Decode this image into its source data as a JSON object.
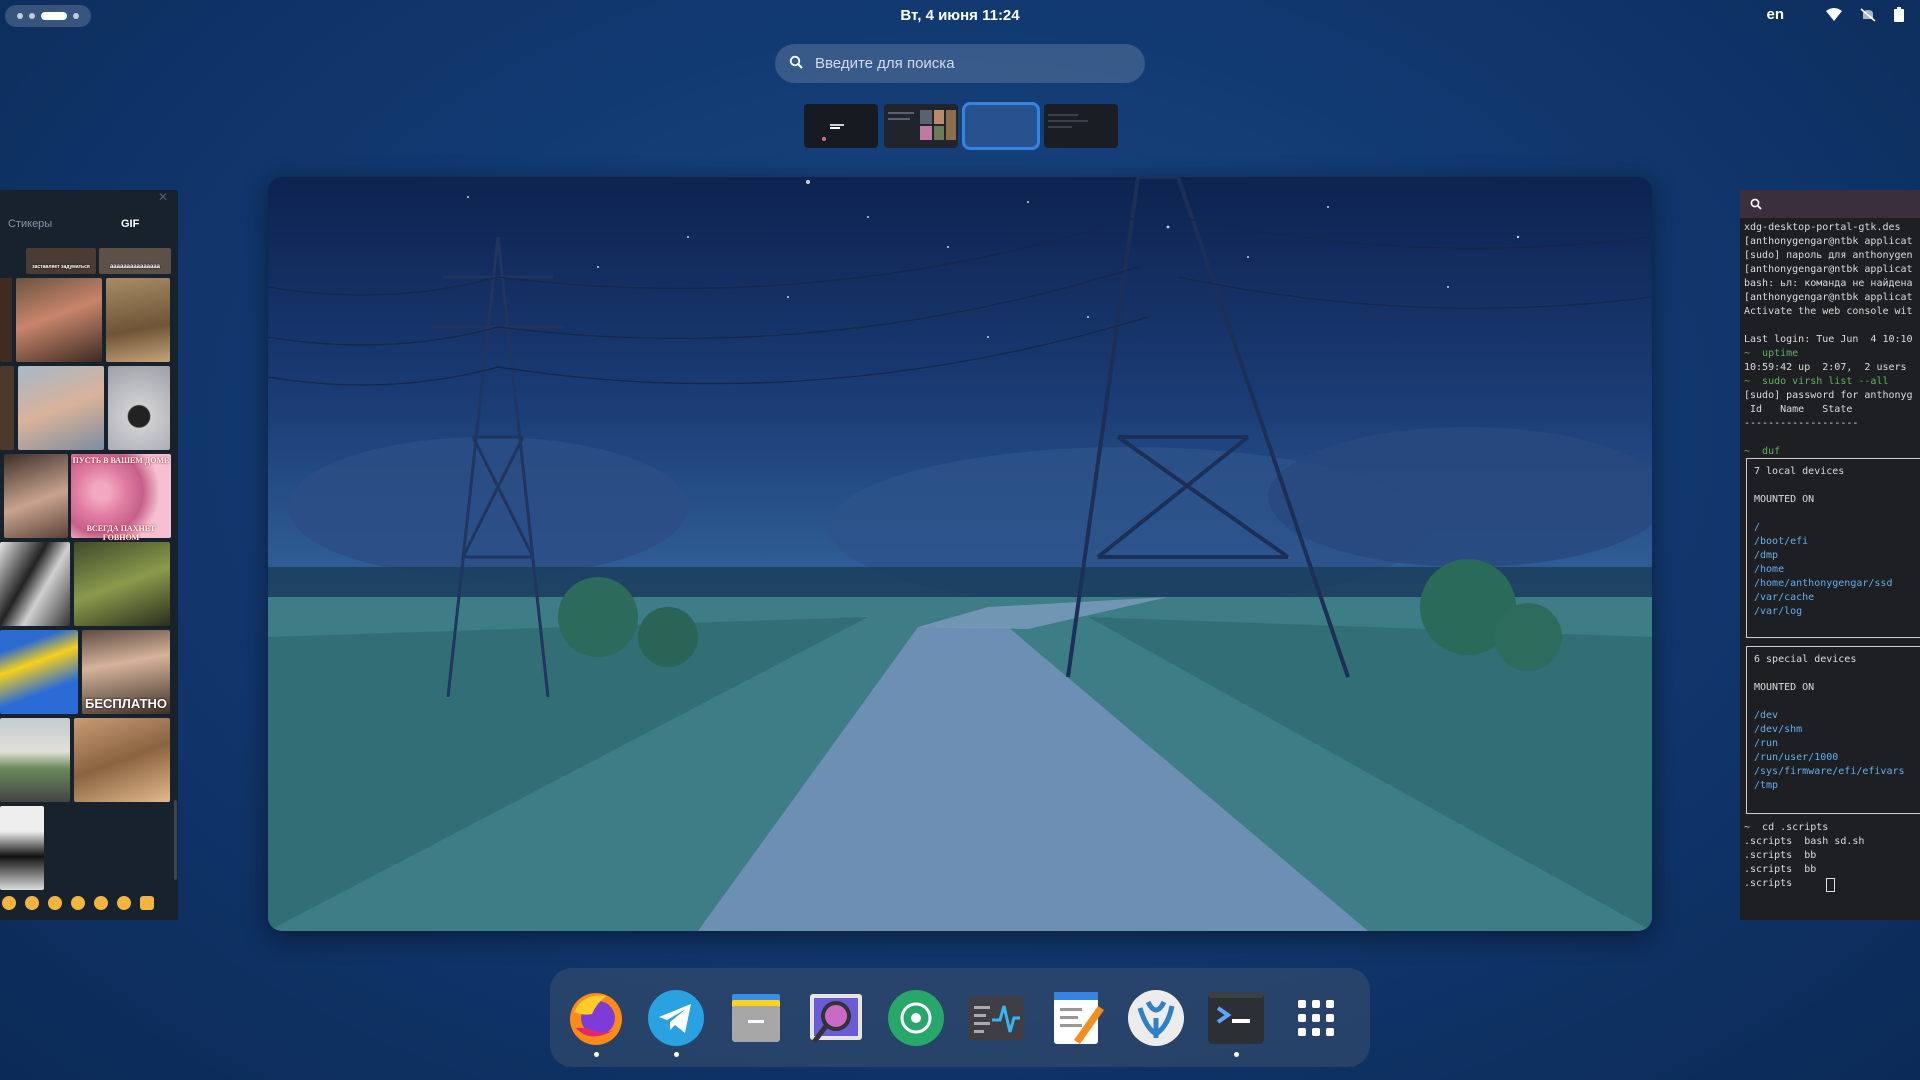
{
  "topbar": {
    "clock": "Вт, 4 июня  11:24",
    "language": "en",
    "icons": [
      "wifi-icon",
      "notifications-off-icon",
      "battery-icon"
    ]
  },
  "search": {
    "placeholder": "Введите для поиска"
  },
  "workspaces": {
    "count": 4,
    "active_index": 2
  },
  "telegram_panel": {
    "tab_stickers": "Стикеры",
    "tab_gif": "GIF",
    "gif_texts": {
      "g1": "заставляет задуматься",
      "g2": "ааааааааааааааа",
      "g3": "ПУСТЬ В ВАШЕМ ДОМЕ",
      "g4": "ВСЕГДА ПАХНЕТ ГОВНОМ",
      "g5": "БЕСПЛАТНО"
    }
  },
  "terminal": {
    "lines": [
      "xdg-desktop-portal-gtk.des",
      "[anthonygengar@ntbk applicat",
      "[sudo] пароль для anthonygen",
      "[anthonygengar@ntbk applicat",
      "bash: ьл: команда не найдена",
      "[anthonygengar@ntbk applicat",
      "Activate the web console wit",
      "",
      "Last login: Tue Jun  4 10:10",
      "~  uptime",
      "10:59:42 up  2:07,  2 users",
      "~  sudo virsh list --all",
      "[sudo] password for anthonyg",
      " Id   Name   State",
      "-------------------",
      "",
      "~  duf"
    ],
    "local_devices_header": "7 local devices",
    "mounted_on_label": "MOUNTED ON",
    "local_mounts": [
      "/",
      "/boot/efi",
      "/dmp",
      "/home",
      "/home/anthonygengar/ssd",
      "/var/cache",
      "/var/log"
    ],
    "special_devices_header": "6 special devices",
    "special_mounts": [
      "/dev",
      "/dev/shm",
      "/run",
      "/run/user/1000",
      "/sys/firmware/efi/efivars",
      "/tmp"
    ],
    "tail_lines": [
      "~  cd .scripts",
      ".scripts  bash sd.sh",
      ".scripts  bb",
      ".scripts  bb",
      ".scripts  "
    ]
  },
  "dock": {
    "apps": [
      {
        "name": "Firefox",
        "icon": "firefox-icon",
        "running": true
      },
      {
        "name": "Telegram",
        "icon": "telegram-icon",
        "running": true
      },
      {
        "name": "Files",
        "icon": "files-icon",
        "running": false
      },
      {
        "name": "Image Viewer",
        "icon": "image-viewer-icon",
        "running": false
      },
      {
        "name": "Music",
        "icon": "music-icon",
        "running": false
      },
      {
        "name": "System Monitor",
        "icon": "system-monitor-icon",
        "running": false
      },
      {
        "name": "Text Editor",
        "icon": "text-editor-icon",
        "running": false
      },
      {
        "name": "VSCodium",
        "icon": "vscodium-icon",
        "running": false
      },
      {
        "name": "Terminal",
        "icon": "terminal-icon",
        "running": true
      },
      {
        "name": "Show Applications",
        "icon": "app-grid-icon",
        "running": false
      }
    ]
  },
  "colors": {
    "accent": "#3584e4",
    "panel_bg": "#18222d",
    "terminal_bg": "#1e1f22"
  }
}
